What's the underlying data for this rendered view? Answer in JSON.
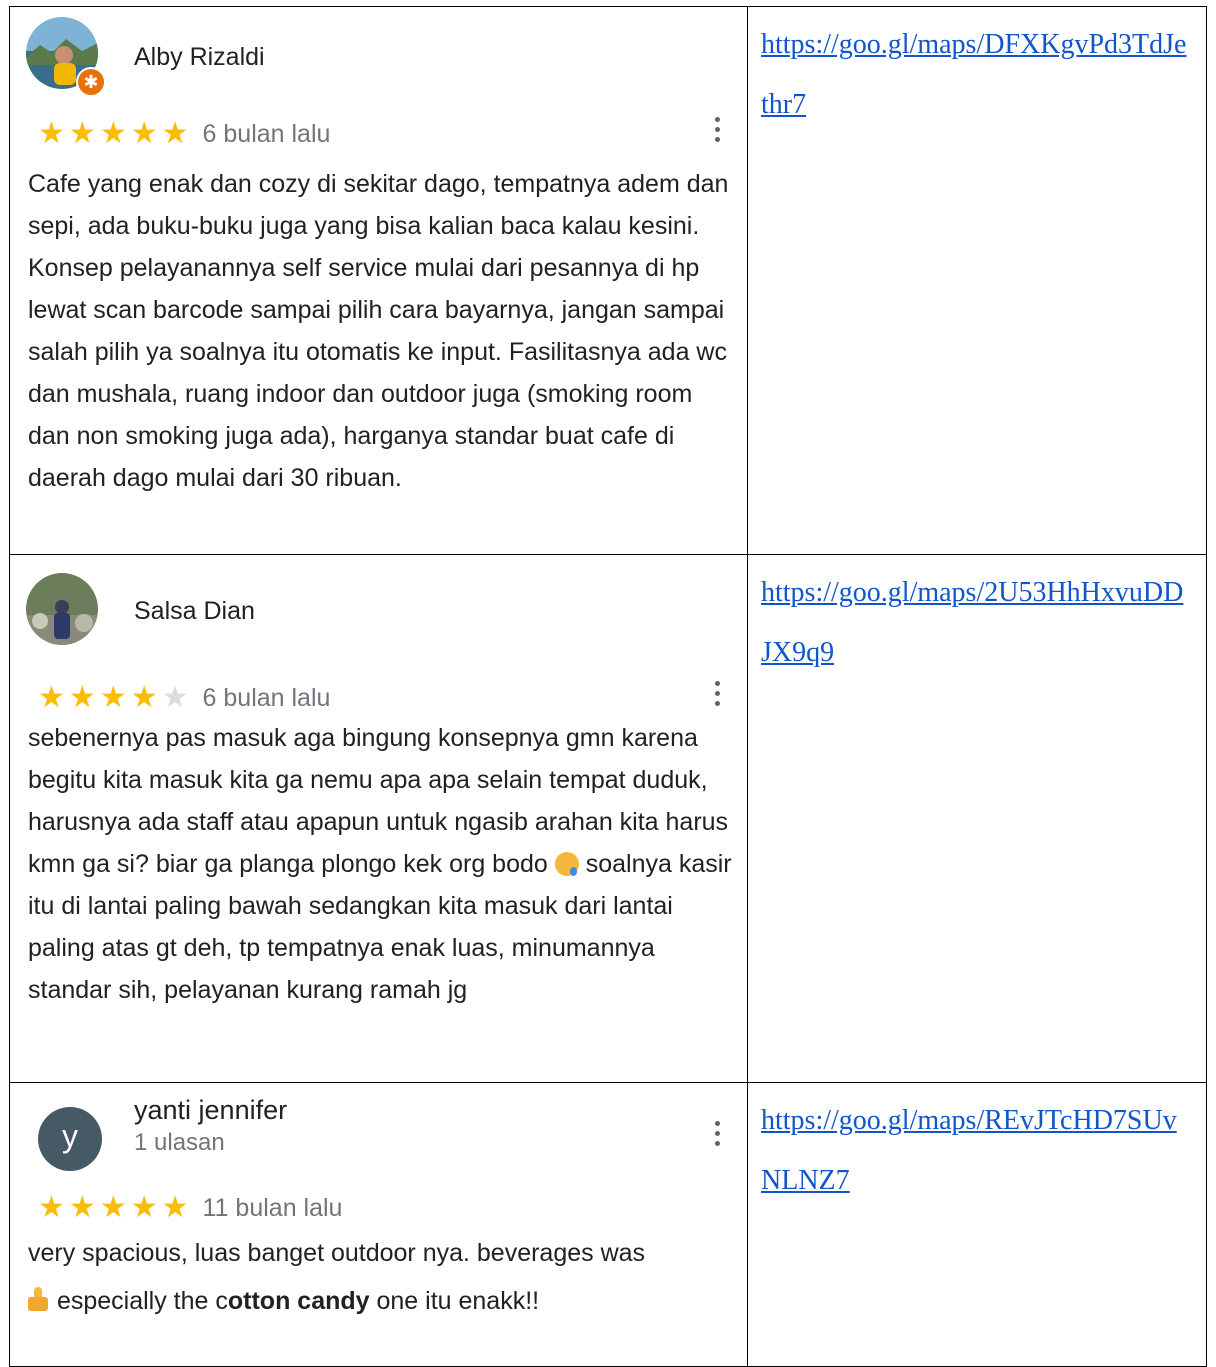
{
  "reviews": [
    {
      "name": "Alby Rizaldi",
      "count": "",
      "stars": 5,
      "date": "6 bulan lalu",
      "text": "Cafe yang enak dan cozy di sekitar dago, tempatnya adem dan sepi, ada buku-buku juga yang bisa kalian baca kalau kesini. Konsep pelayanannya self service mulai dari pesannya di hp lewat scan barcode sampai pilih cara bayarnya, jangan sampai salah pilih ya soalnya itu otomatis ke input. Fasilitasnya ada wc dan mushala, ruang indoor dan outdoor juga (smoking room dan non smoking juga ada), harganya standar buat cafe di daerah dago mulai dari 30 ribuan.",
      "link": "https://goo.gl/maps/DFXKgvPd3TdJethr7"
    },
    {
      "name": "Salsa Dian",
      "count": "",
      "stars": 4,
      "date": "6 bulan lalu",
      "text_before_emoji": "sebenernya pas masuk aga bingung konsepnya gmn karena begitu kita masuk kita ga nemu apa apa selain tempat duduk, harusnya ada staff atau apapun untuk ngasib arahan kita harus kmn ga si? biar ga planga plongo kek org bodo",
      "text_after_emoji": " soalnya kasir itu di lantai paling bawah sedangkan kita masuk dari lantai paling atas gt deh, tp tempatnya enak luas, minumannya standar sih, pelayanan kurang ramah jg",
      "link": "https://goo.gl/maps/2U53HhHxvuDDJX9q9"
    },
    {
      "name": "yanti jennifer",
      "avatar_letter": "y",
      "count": "1 ulasan",
      "stars": 5,
      "date": "11 bulan lalu",
      "text_line1": "very spacious, luas banget outdoor nya. beverages was",
      "text_pre": " especially the c",
      "text_bold": "otton candy",
      "text_post": " one itu enakk!!",
      "link": "https://goo.gl/maps/REvJTcHD7SUvNLNZ7"
    }
  ],
  "colors": {
    "star_on": "#fbbc04",
    "star_off": "#dadce0",
    "link": "#1155cc",
    "avatar_letter_bg": "#455a64"
  }
}
